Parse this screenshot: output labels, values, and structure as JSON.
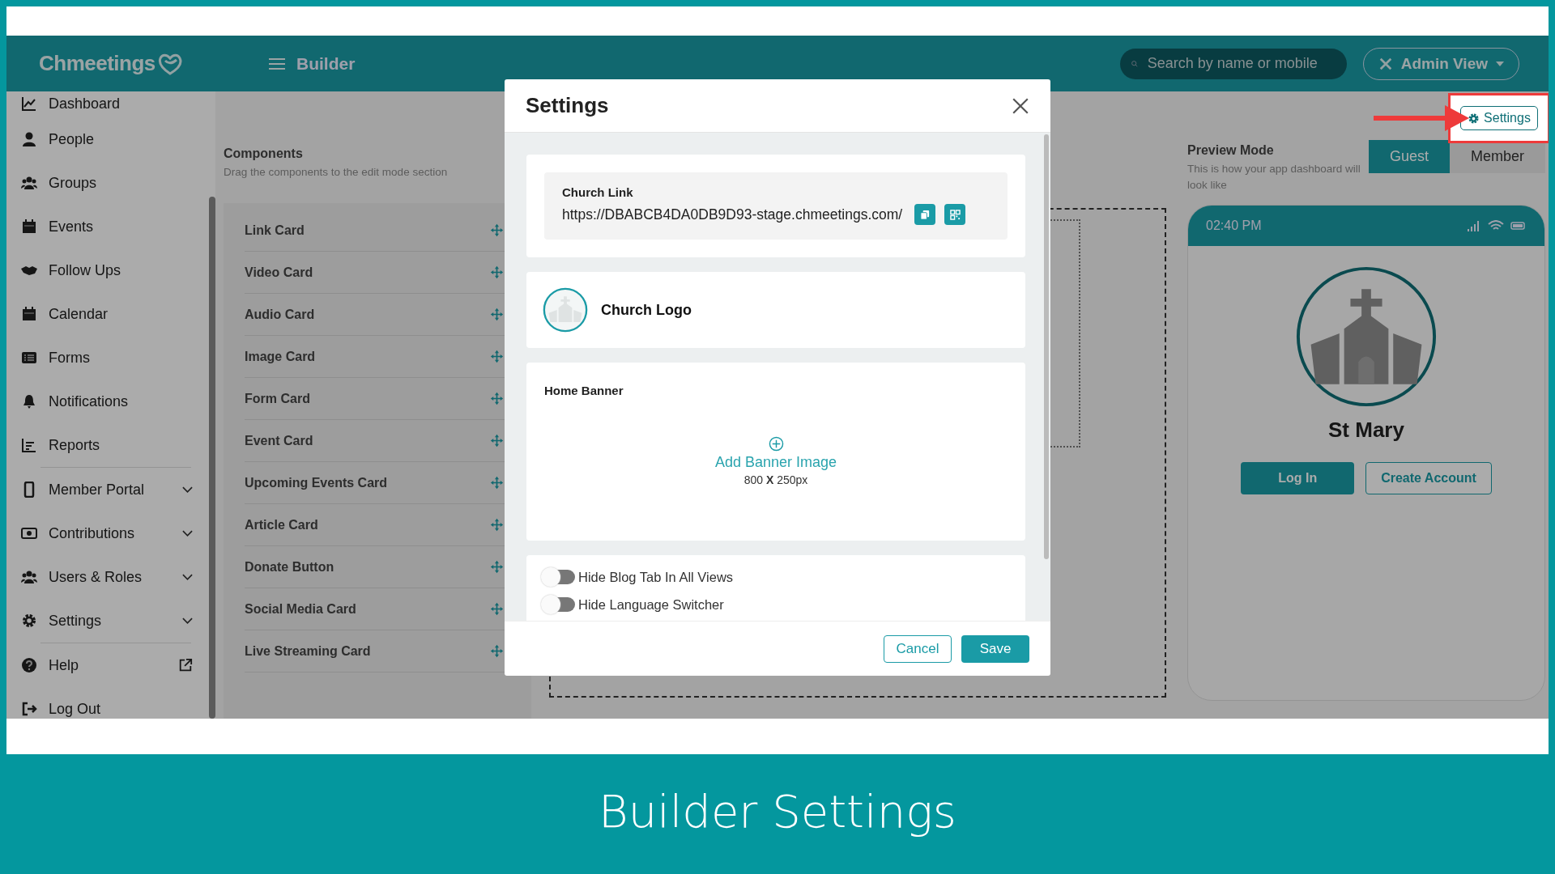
{
  "header": {
    "logo": "Chmeetings",
    "page_title": "Builder",
    "search": {
      "placeholder": "Search by name or mobile"
    },
    "view_menu": "Admin View"
  },
  "sidebar": {
    "groups": [
      [
        {
          "label": "Dashboard",
          "kind": "plain"
        },
        {
          "label": "People",
          "kind": "plain"
        },
        {
          "label": "Groups",
          "kind": "plain"
        },
        {
          "label": "Events",
          "kind": "plain"
        },
        {
          "label": "Follow Ups",
          "kind": "plain"
        },
        {
          "label": "Calendar",
          "kind": "plain"
        },
        {
          "label": "Forms",
          "kind": "plain"
        },
        {
          "label": "Notifications",
          "kind": "plain"
        },
        {
          "label": "Reports",
          "kind": "plain"
        }
      ],
      [
        {
          "label": "Member Portal",
          "kind": "dropdown"
        },
        {
          "label": "Contributions",
          "kind": "dropdown"
        },
        {
          "label": "Users & Roles",
          "kind": "dropdown"
        },
        {
          "label": "Settings",
          "kind": "dropdown"
        }
      ],
      [
        {
          "label": "Help",
          "kind": "external"
        },
        {
          "label": "Log Out",
          "kind": "plain"
        }
      ]
    ]
  },
  "components": {
    "title": "Components",
    "hint": "Drag the components to the edit mode section",
    "items": [
      "Link Card",
      "Video Card",
      "Audio Card",
      "Image Card",
      "Form Card",
      "Event Card",
      "Upcoming Events Card",
      "Article Card",
      "Donate Button",
      "Social Media Card",
      "Live Streaming Card"
    ]
  },
  "settings_button": {
    "label": "Settings"
  },
  "preview": {
    "title": "Preview Mode",
    "hint": "This is how your app dashboard will look like",
    "tabs": [
      {
        "label": "Guest",
        "selected": true
      },
      {
        "label": "Member",
        "selected": false
      }
    ],
    "phone_time": "02:40 PM",
    "church_name": "St Mary",
    "buttons": [
      {
        "label": "Log In",
        "kind": "primary"
      },
      {
        "label": "Create Account",
        "kind": "outline"
      }
    ]
  },
  "modal": {
    "title": "Settings",
    "church_link": {
      "label": "Church Link",
      "url": "https://DBABCB4DA0DB9D93-stage.chmeetings.com/"
    },
    "church_logo": "Church Logo",
    "home_banner": {
      "title": "Home Banner",
      "action": "Add Banner Image",
      "size": "800 **X** 250px"
    },
    "toggles": [
      {
        "label": "Hide Blog Tab In All Views",
        "on": false
      },
      {
        "label": "Hide Language Switcher",
        "on": false
      }
    ],
    "buttons": [
      {
        "label": "Cancel",
        "kind": "outline"
      },
      {
        "label": "Save",
        "kind": "primary"
      }
    ]
  },
  "caption": "Builder Settings"
}
